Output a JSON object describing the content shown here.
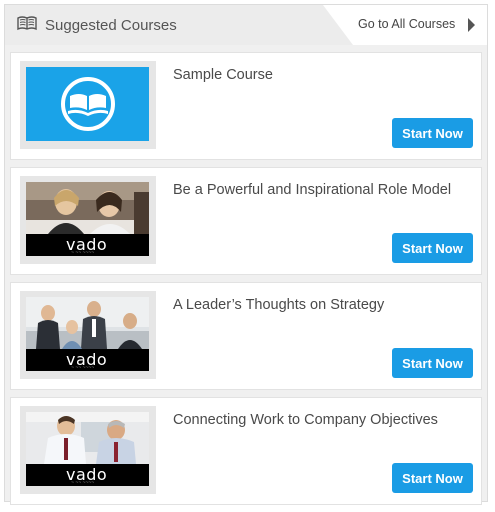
{
  "header": {
    "title": "Suggested Courses",
    "goto_label": "Go to All Courses",
    "icon": "open-book-icon"
  },
  "courses": [
    {
      "title": "Sample Course",
      "button": "Start Now",
      "thumbnail": "book-logo",
      "brand": ""
    },
    {
      "title": "Be a Powerful and Inspirational Role Model",
      "button": "Start Now",
      "thumbnail": "photo",
      "brand": "vado"
    },
    {
      "title": "A Leader’s Thoughts on Strategy",
      "button": "Start Now",
      "thumbnail": "photo",
      "brand": "vado"
    },
    {
      "title": "Connecting Work to Company Objectives",
      "button": "Start Now",
      "thumbnail": "photo",
      "brand": "vado"
    }
  ],
  "colors": {
    "accent": "#1a9ce5",
    "thumb_blue": "#1aa3e8"
  }
}
